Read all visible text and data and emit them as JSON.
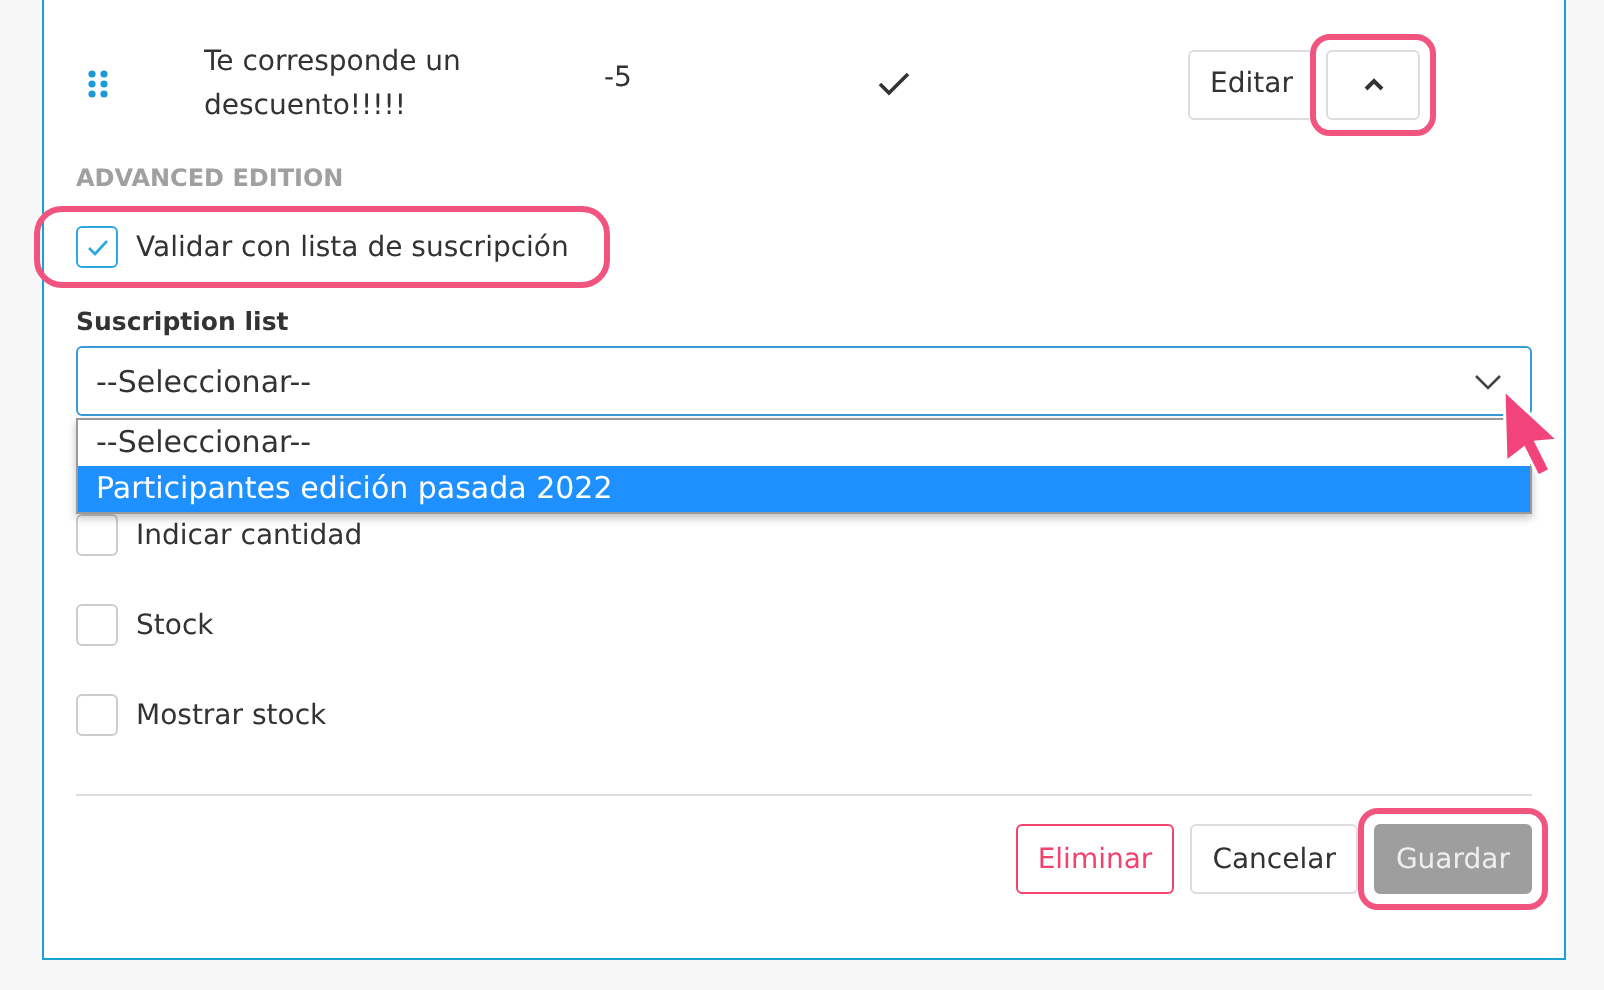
{
  "item": {
    "title": "Te corresponde un descuento!!!!!",
    "value": "-5",
    "active": true,
    "edit_button": "Editar",
    "expanded": true,
    "expand_highlighted": true
  },
  "advanced": {
    "heading": "ADVANCED EDITION",
    "validate": {
      "label": "Validar con lista de suscripción",
      "checked": true,
      "highlighted": true
    },
    "list_label": "Suscription list",
    "select": {
      "value": "--Seleccionar--",
      "open": true,
      "options": [
        {
          "label": "--Seleccionar--",
          "highlighted": false
        },
        {
          "label": "Participantes edición pasada 2022",
          "highlighted": true
        }
      ]
    },
    "options": [
      {
        "label": "Indicar cantidad",
        "checked": false
      },
      {
        "label": "Stock",
        "checked": false
      },
      {
        "label": "Mostrar stock",
        "checked": false
      }
    ]
  },
  "buttons": [
    {
      "label": "Eliminar",
      "kind": "danger",
      "highlighted": false
    },
    {
      "label": "Cancelar",
      "kind": "default",
      "highlighted": false
    },
    {
      "label": "Guardar",
      "kind": "disabled",
      "highlighted": true
    }
  ],
  "cursor": true
}
